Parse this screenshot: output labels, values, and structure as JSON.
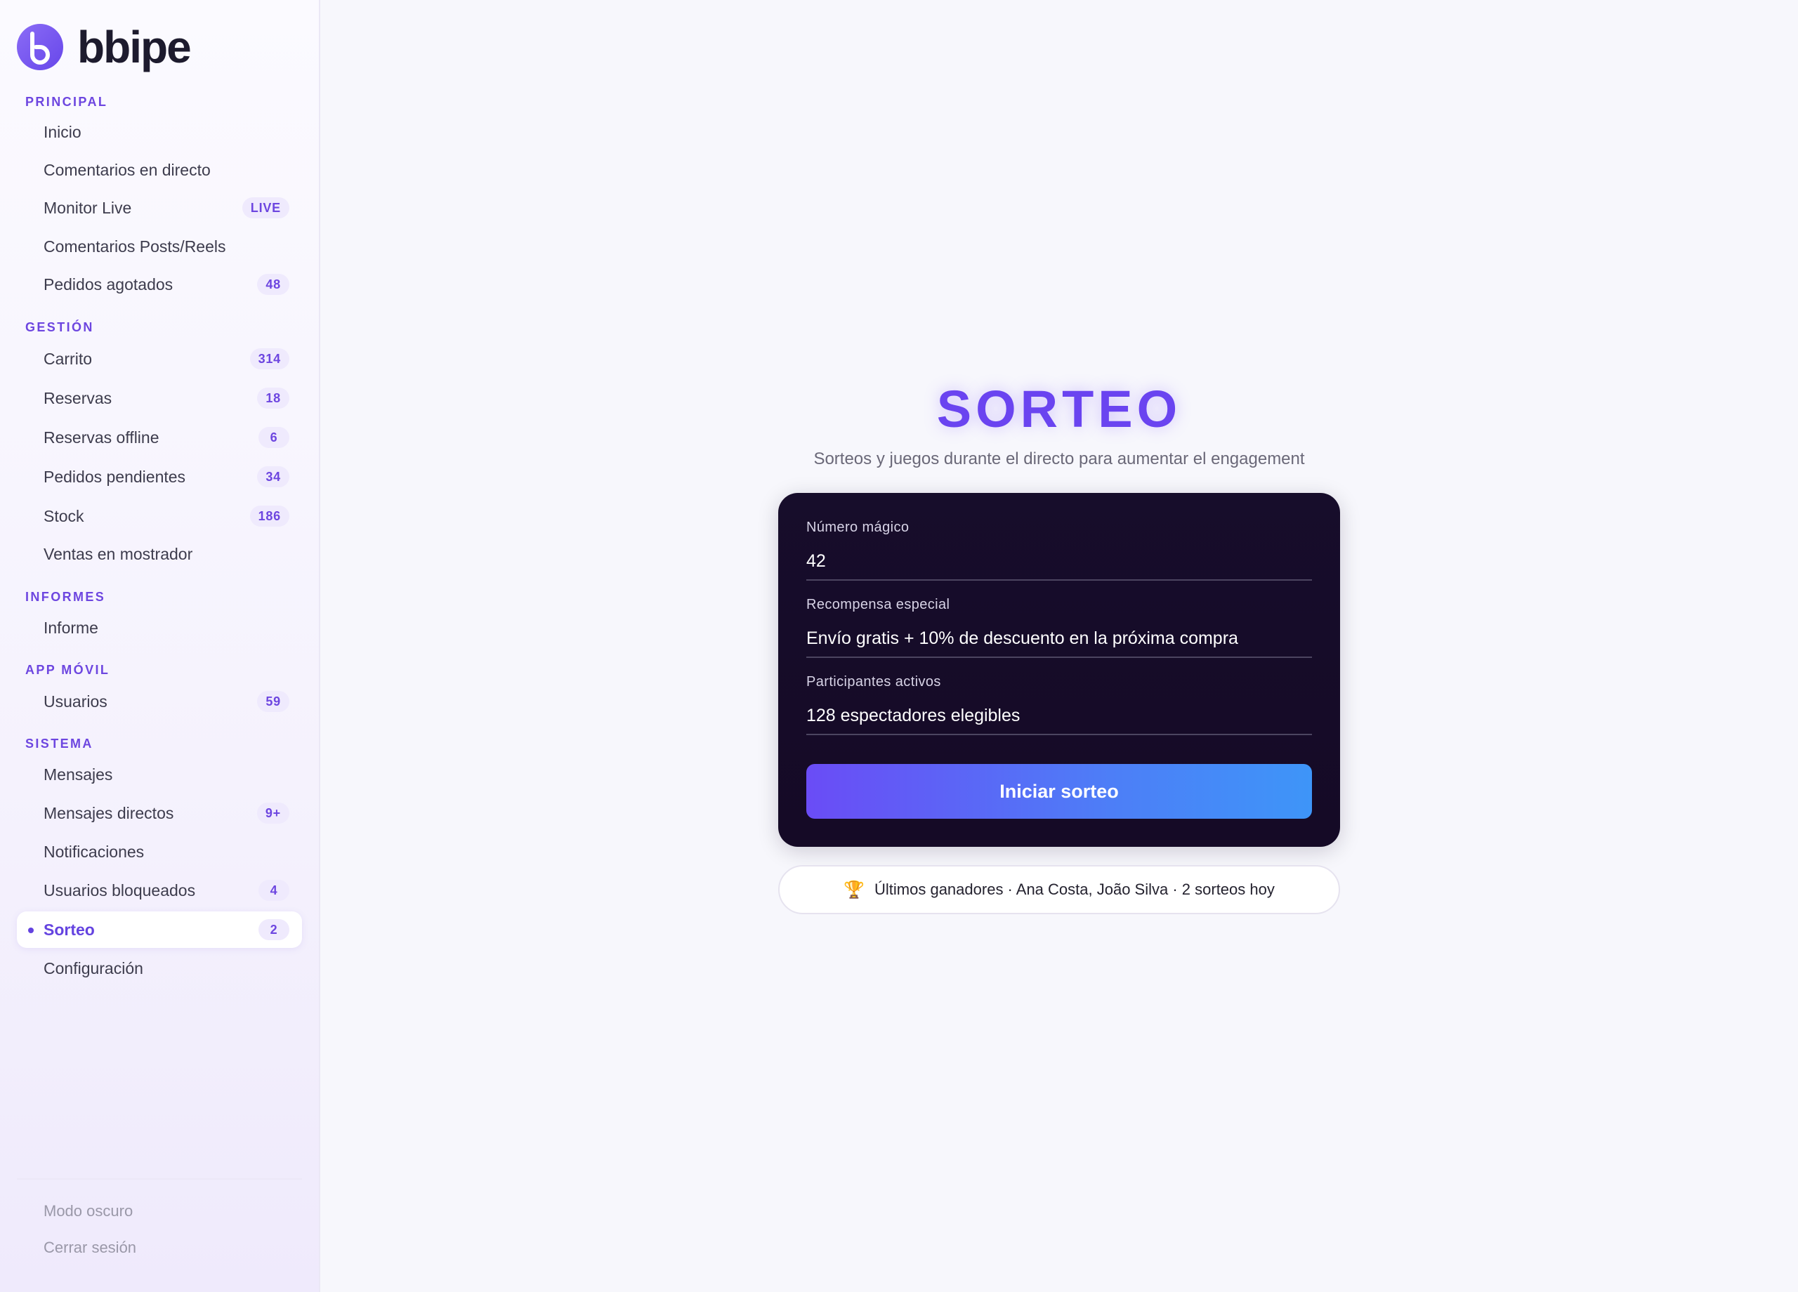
{
  "brand": {
    "name": "bbipe"
  },
  "sidebar": {
    "sections": {
      "principal": "PRINCIPAL",
      "gestion": "GESTIÓN",
      "informes": "INFORMES",
      "app_movil": "APP MÓVIL",
      "sistema": "SISTEMA"
    },
    "items": {
      "inicio": {
        "label": "Inicio"
      },
      "comentarios_directo": {
        "label": "Comentarios en directo"
      },
      "monitor_live": {
        "label": "Monitor Live",
        "badge": "LIVE"
      },
      "comentarios_posts": {
        "label": "Comentarios Posts/Reels"
      },
      "pedidos_agotados": {
        "label": "Pedidos agotados",
        "badge": "48"
      },
      "carrito": {
        "label": "Carrito",
        "badge": "314"
      },
      "reservas": {
        "label": "Reservas",
        "badge": "18"
      },
      "reservas_offline": {
        "label": "Reservas offline",
        "badge": "6"
      },
      "pedidos_pendientes": {
        "label": "Pedidos pendientes",
        "badge": "34"
      },
      "stock": {
        "label": "Stock",
        "badge": "186"
      },
      "ventas_mostrador": {
        "label": "Ventas en mostrador"
      },
      "informe": {
        "label": "Informe"
      },
      "usuarios": {
        "label": "Usuarios",
        "badge": "59"
      },
      "mensajes": {
        "label": "Mensajes"
      },
      "mensajes_directos": {
        "label": "Mensajes directos",
        "badge": "9+"
      },
      "notificaciones": {
        "label": "Notificaciones"
      },
      "usuarios_bloqueados": {
        "label": "Usuarios bloqueados",
        "badge": "4"
      },
      "sorteo": {
        "label": "Sorteo",
        "badge": "2",
        "active": true
      },
      "configuracion": {
        "label": "Configuración"
      }
    },
    "footer": {
      "dark_mode": "Modo oscuro",
      "logout": "Cerrar sesión"
    }
  },
  "main": {
    "title": "SORTEO",
    "subtitle": "Sorteos y juegos durante el directo para aumentar el engagement",
    "form": {
      "magic_number": {
        "label": "Número mágico",
        "value": "42"
      },
      "reward": {
        "label": "Recompensa especial",
        "value": "Envío gratis + 10% de descuento en la próxima compra"
      },
      "participants": {
        "label": "Participantes activos",
        "value": "128 espectadores elegibles"
      },
      "start_button": "Iniciar sorteo"
    },
    "winners": {
      "icon": "trophy-icon",
      "text": "Últimos ganadores · Ana Costa, João Silva · 2 sorteos hoy"
    }
  },
  "colors": {
    "accent": "#6a44f0",
    "card_bg": "#170d2b",
    "button_gradient_start": "#6a4cf6",
    "button_gradient_end": "#3e95f8"
  }
}
